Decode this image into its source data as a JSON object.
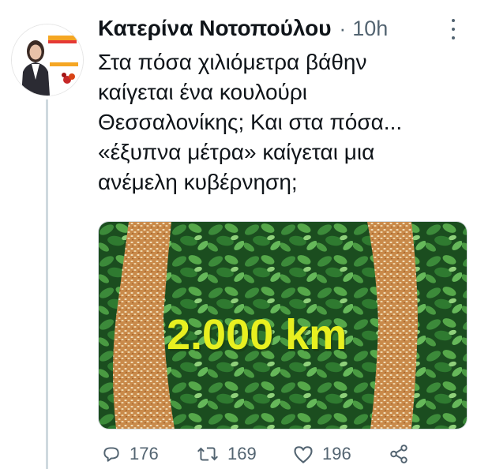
{
  "tweet": {
    "author_name": "Κατερίνα Νοτοπούλου",
    "separator": "·",
    "time": "10h",
    "lines": [
      "Στα πόσα χιλιόμετρα βάθην",
      "καίγεται ένα κουλούρι",
      "Θεσσαλονίκης; Και στα πόσα...",
      "«έξυπνα μέτρα» καίγεται μια",
      "ανέμελη κυβέρνηση;"
    ]
  },
  "avatar": {
    "banner_top": "Κατερίνα",
    "banner_bottom": "Νοτοπούλου"
  },
  "media": {
    "overlay_text": "2.000 km",
    "overlay_color": "#e8f020",
    "leaf_color": "#2e7d32"
  },
  "actions": {
    "reply_count": "176",
    "retweet_count": "169",
    "like_count": "196"
  },
  "colors": {
    "text": "#0f1419",
    "secondary": "#536471",
    "line": "#cfd9de"
  }
}
